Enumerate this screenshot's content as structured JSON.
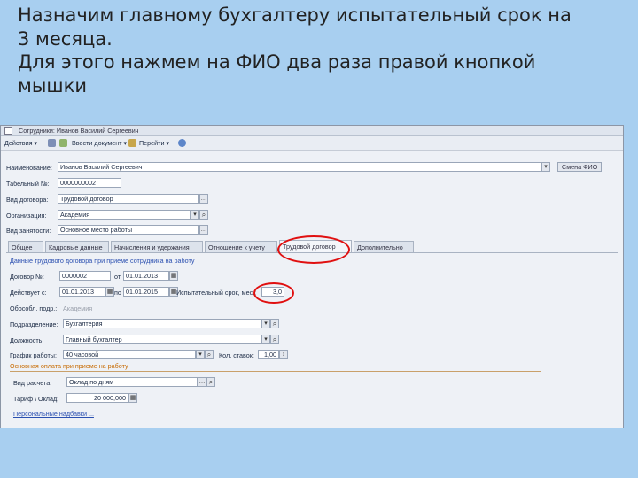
{
  "slide": {
    "lines": [
      "Назначим главному бухгалтеру испытательный срок на",
      "3 месяца.",
      "Для этого нажмем на ФИО два раза правой кнопкой",
      "мышки"
    ]
  },
  "window": {
    "title": "Сотрудники: Иванов Василий Сергеевич",
    "toolbar": {
      "actions": "Действия",
      "enter_doc": "Ввести документ",
      "goto": "Перейти"
    },
    "header": {
      "name_label": "Наименование:",
      "name_value": "Иванов Василий Сергеевич",
      "fio_button": "Смена ФИО",
      "tab_no_label": "Табельный №:",
      "tab_no_value": "0000000002",
      "contract_type_label": "Вид договора:",
      "contract_type_value": "Трудовой договор",
      "org_label": "Организация:",
      "org_value": "Академия",
      "employment_label": "Вид занятости:",
      "employment_value": "Основное место работы"
    },
    "tabs": [
      "Общее",
      "Кадровые данные",
      "Начисления и удержания",
      "Отношение к учету",
      "Трудовой договор",
      "Дополнительно"
    ],
    "active_tab_index": 4,
    "contract": {
      "section_title": "Данные трудового договора при приеме сотрудника на работу",
      "contract_no_label": "Договор №:",
      "contract_no_value": "0000002",
      "from_label": "от",
      "from_value": "01.01.2013",
      "valid_label": "Действует с:",
      "valid_from": "01.01.2013",
      "to_label": "по",
      "valid_to": "01.01.2015",
      "probation_label": "Испытательный срок, мес.:",
      "probation_value": "3,0",
      "sep_div_label": "Обособл. подр.:",
      "sep_div_value": "Академия",
      "department_label": "Подразделение:",
      "department_value": "Бухгалтерия",
      "position_label": "Должность:",
      "position_value": "Главный бухгалтер",
      "schedule_label": "График работы:",
      "schedule_value": "40 часовой",
      "rates_label": "Кол. ставок:",
      "rates_value": "1,00"
    },
    "payment": {
      "section_title": "Основная оплата при приеме на работу",
      "calc_type_label": "Вид расчета:",
      "calc_type_value": "Оклад по дням",
      "tariff_label": "Тариф \\ Оклад:",
      "tariff_value": "20 000,000",
      "allowances_link": "Персональные надбавки ..."
    }
  },
  "colors": {
    "slide_background": "#a8cff0",
    "highlight_oval": "#e01010",
    "section_title": "#c76a00"
  }
}
